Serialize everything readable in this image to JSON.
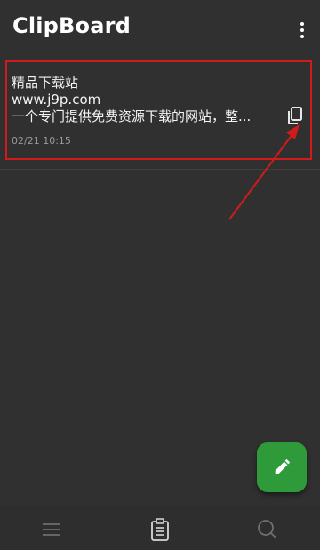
{
  "header": {
    "title": "ClipBoard",
    "overflow_icon": "more-vertical-icon"
  },
  "clips": [
    {
      "lines": [
        "精品下载站",
        "www.j9p.com",
        "一个专门提供免费资源下载的网站，整..."
      ],
      "time": "02/21 10:15",
      "copy_icon": "copy-icon"
    }
  ],
  "fab": {
    "icon": "pencil-icon",
    "color": "#2e9a3a"
  },
  "bottom_nav": {
    "items": [
      {
        "icon": "menu-icon"
      },
      {
        "icon": "clipboard-icon",
        "active": true
      },
      {
        "icon": "search-icon"
      }
    ]
  },
  "annotation": {
    "color": "#d11b1b"
  }
}
